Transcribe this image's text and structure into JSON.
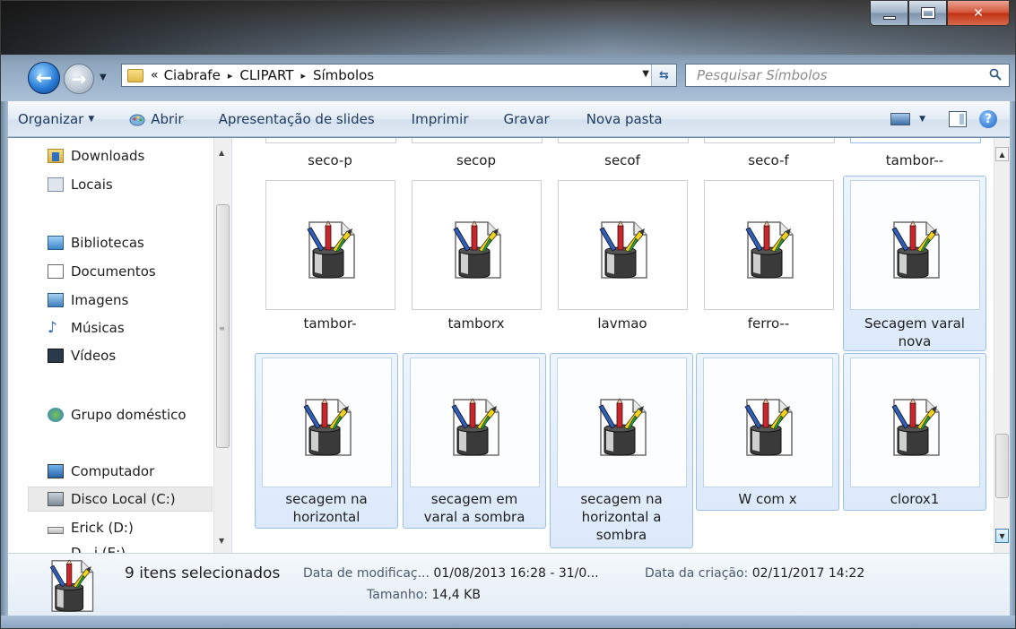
{
  "address": {
    "overflow": "«",
    "crumbs": [
      "Ciabrafe",
      "CLIPART",
      "Símbolos"
    ],
    "separator": "▸"
  },
  "search": {
    "placeholder": "Pesquisar Símbolos"
  },
  "commands": {
    "organize": "Organizar",
    "open": "Abrir",
    "slideshow": "Apresentação de slides",
    "print": "Imprimir",
    "burn": "Gravar",
    "new_folder": "Nova pasta"
  },
  "nav": {
    "downloads": "Downloads",
    "locais": "Locais",
    "libraries": "Bibliotecas",
    "documents": "Documentos",
    "pictures": "Imagens",
    "music": "Músicas",
    "videos": "Vídeos",
    "homegroup": "Grupo doméstico",
    "computer": "Computador",
    "local_disk": "Disco Local (C:)",
    "erick": "Erick (D:)",
    "partial": "D...i (E:)"
  },
  "top_row": [
    "seco-p",
    "secop",
    "secof",
    "seco-f",
    "tambor--"
  ],
  "files": [
    {
      "line1": "tambor-",
      "line2": "",
      "line3": "",
      "selected": false
    },
    {
      "line1": "tamborx",
      "line2": "",
      "line3": "",
      "selected": false
    },
    {
      "line1": "lavmao",
      "line2": "",
      "line3": "",
      "selected": false
    },
    {
      "line1": "ferro--",
      "line2": "",
      "line3": "",
      "selected": false
    },
    {
      "line1": "Secagem varal",
      "line2": "nova",
      "line3": "",
      "selected": true
    },
    {
      "line1": "secagem na",
      "line2": "horizontal",
      "line3": "",
      "selected": true
    },
    {
      "line1": "secagem em",
      "line2": "varal a sombra",
      "line3": "",
      "selected": true
    },
    {
      "line1": "secagem na",
      "line2": "horizontal a",
      "line3": "sombra",
      "selected": true
    },
    {
      "line1": "W com x",
      "line2": "",
      "line3": "",
      "selected": true
    },
    {
      "line1": "clorox1",
      "line2": "",
      "line3": "",
      "selected": true
    }
  ],
  "details": {
    "selection": "9 itens selecionados",
    "modified_label": "Data de modificaç...",
    "modified_value": "01/08/2013 16:28 - 31/0...",
    "created_label": "Data da criação:",
    "created_value": "02/11/2017 14:22",
    "size_label": "Tamanho:",
    "size_value": "14,4 KB"
  },
  "icons": {
    "file_icon": "clipart-pencil-cup-document-icon",
    "back": "back-arrow-icon",
    "forward": "forward-arrow-icon"
  }
}
